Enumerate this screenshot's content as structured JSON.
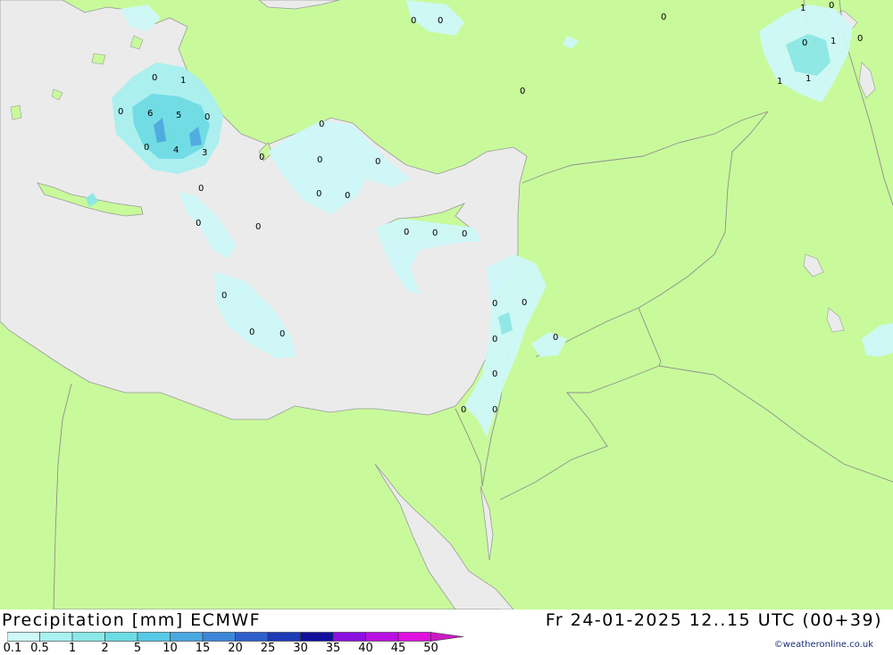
{
  "header": {
    "title": "Precipitation [mm] ECMWF",
    "datetime": "Fr 24-01-2025 12..15 UTC (00+39)"
  },
  "credit": "©weatheronline.co.uk",
  "colors": {
    "land": "#c8fa9b",
    "sea": "#ebebeb",
    "border": "#999999"
  },
  "legend": {
    "values": [
      "0.1",
      "0.5",
      "1",
      "2",
      "5",
      "10",
      "15",
      "20",
      "25",
      "30",
      "35",
      "40",
      "45",
      "50"
    ],
    "colors": [
      "#cff8f8",
      "#a9f0f0",
      "#8ce8e8",
      "#6cdce4",
      "#56c9e6",
      "#4aa8e0",
      "#3c86d8",
      "#2e5fcc",
      "#1e3ab8",
      "#10109c",
      "#8c10e0",
      "#b810e0",
      "#e010e0",
      "#c81cc0"
    ]
  },
  "map_labels": [
    {
      "text": "0"
    },
    {
      "text": "0"
    },
    {
      "text": "0"
    },
    {
      "text": "1"
    },
    {
      "text": "0"
    },
    {
      "text": "0"
    },
    {
      "text": "1"
    },
    {
      "text": "0"
    },
    {
      "text": "1"
    },
    {
      "text": "1"
    },
    {
      "text": "0"
    },
    {
      "text": "1"
    },
    {
      "text": "0"
    },
    {
      "text": "6"
    },
    {
      "text": "5"
    },
    {
      "text": "0"
    },
    {
      "text": "0"
    },
    {
      "text": "4"
    },
    {
      "text": "3"
    },
    {
      "text": "0"
    },
    {
      "text": "0"
    },
    {
      "text": "0"
    },
    {
      "text": "0"
    },
    {
      "text": "0"
    },
    {
      "text": "0"
    },
    {
      "text": "0"
    },
    {
      "text": "0"
    },
    {
      "text": "0"
    },
    {
      "text": "0"
    },
    {
      "text": "0"
    },
    {
      "text": "0"
    },
    {
      "text": "0"
    },
    {
      "text": "0"
    },
    {
      "text": "0"
    },
    {
      "text": "0"
    },
    {
      "text": "0"
    },
    {
      "text": "0"
    },
    {
      "text": "0"
    },
    {
      "text": "0"
    },
    {
      "text": "0"
    },
    {
      "text": "0"
    }
  ]
}
